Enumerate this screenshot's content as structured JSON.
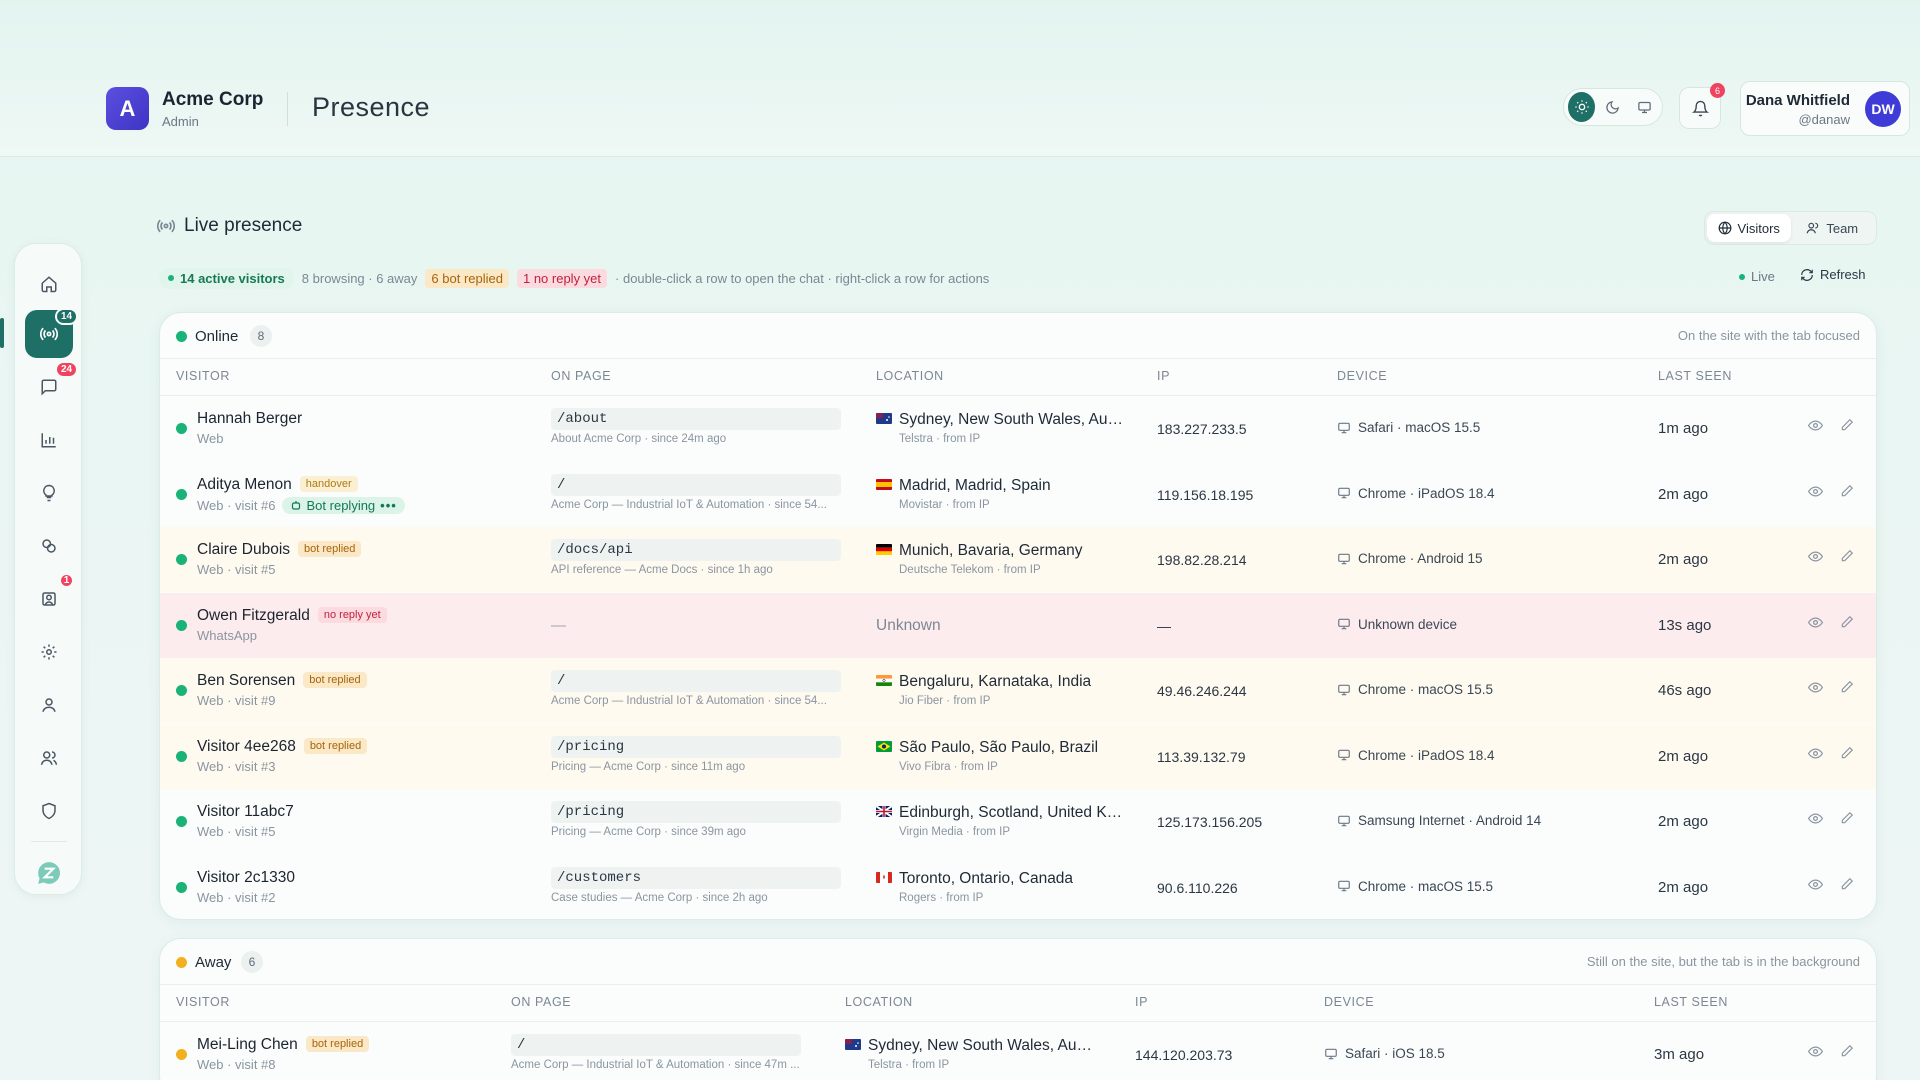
{
  "header": {
    "logo_letter": "A",
    "org_name": "Acme Corp",
    "org_role": "Admin",
    "page_title": "Presence",
    "notification_count": "6",
    "user_name": "Dana Whitfield",
    "user_handle": "@danaw",
    "user_initials": "DW"
  },
  "sidebar": {
    "items": [
      {
        "name": "home",
        "icon": "home-icon"
      },
      {
        "name": "presence",
        "icon": "broadcast-icon",
        "badge": "14",
        "active": true
      },
      {
        "name": "chats",
        "icon": "chat-icon",
        "badge": "24"
      },
      {
        "name": "analytics",
        "icon": "bar-chart-icon"
      },
      {
        "name": "ideas",
        "icon": "lightbulb-icon"
      },
      {
        "name": "integrations",
        "icon": "link-icon"
      },
      {
        "name": "tickets",
        "icon": "inbox-icon",
        "badge": "1"
      },
      {
        "name": "settings",
        "icon": "gear-icon"
      },
      {
        "name": "profile",
        "icon": "user-icon"
      },
      {
        "name": "team",
        "icon": "users-icon"
      },
      {
        "name": "security",
        "icon": "shield-icon"
      },
      {
        "name": "app",
        "icon": "app-logo-icon"
      }
    ]
  },
  "presence": {
    "title": "Live presence",
    "tabs": {
      "visitors": "Visitors",
      "team": "Team"
    },
    "stats": {
      "active": "14 active visitors",
      "browsing_away": "8 browsing · 6 away",
      "bot_replied": "6 bot replied",
      "no_reply": "1 no reply yet",
      "hint": "· double-click a row to open the chat · right-click a row for actions"
    },
    "live_label": "Live",
    "refresh_label": "Refresh"
  },
  "columns": {
    "visitor": "VISITOR",
    "on_page": "ON PAGE",
    "location": "LOCATION",
    "ip": "IP",
    "device": "DEVICE",
    "last_seen": "LAST SEEN"
  },
  "online": {
    "label": "Online",
    "count": "8",
    "note": "On the site with the tab focused",
    "rows": [
      {
        "name": "Hannah Berger",
        "sub": "Web",
        "tag": "",
        "bot": "",
        "page": "/about",
        "page_sub": "About Acme Corp · since 24m ago",
        "location": "Sydney, New South Wales, Aus...",
        "loc_sub": "Telstra · from IP",
        "flag": "au",
        "ip": "183.227.233.5",
        "device": "Safari · macOS 15.5",
        "seen": "1m ago",
        "tint": ""
      },
      {
        "name": "Aditya Menon",
        "sub": "Web · visit #6",
        "tag": "handover",
        "bot": "Bot replying",
        "page": "/",
        "page_sub": "Acme Corp — Industrial IoT & Automation · since 54...",
        "location": "Madrid, Madrid, Spain",
        "loc_sub": "Movistar · from IP",
        "flag": "es",
        "ip": "119.156.18.195",
        "device": "Chrome · iPadOS 18.4",
        "seen": "2m ago",
        "tint": ""
      },
      {
        "name": "Claire Dubois",
        "sub": "Web · visit #5",
        "tag": "bot replied",
        "bot": "",
        "page": "/docs/api",
        "page_sub": "API reference — Acme Docs · since 1h ago",
        "location": "Munich, Bavaria, Germany",
        "loc_sub": "Deutsche Telekom · from IP",
        "flag": "de",
        "ip": "198.82.28.214",
        "device": "Chrome · Android 15",
        "seen": "2m ago",
        "tint": "yellow"
      },
      {
        "name": "Owen Fitzgerald",
        "sub": "WhatsApp",
        "tag": "no reply yet",
        "bot": "",
        "page": "—",
        "page_sub": "",
        "location": "Unknown",
        "loc_sub": "",
        "flag": "",
        "ip": "—",
        "device": "Unknown device",
        "seen": "13s ago",
        "tint": "red"
      },
      {
        "name": "Ben Sorensen",
        "sub": "Web · visit #9",
        "tag": "bot replied",
        "bot": "",
        "page": "/",
        "page_sub": "Acme Corp — Industrial IoT & Automation · since 54...",
        "location": "Bengaluru, Karnataka, India",
        "loc_sub": "Jio Fiber · from IP",
        "flag": "in",
        "ip": "49.46.246.244",
        "device": "Chrome · macOS 15.5",
        "seen": "46s ago",
        "tint": "yellow"
      },
      {
        "name": "Visitor 4ee268",
        "sub": "Web · visit #3",
        "tag": "bot replied",
        "bot": "",
        "page": "/pricing",
        "page_sub": "Pricing — Acme Corp · since 11m ago",
        "location": "São Paulo, São Paulo, Brazil",
        "loc_sub": "Vivo Fibra · from IP",
        "flag": "br",
        "ip": "113.39.132.79",
        "device": "Chrome · iPadOS 18.4",
        "seen": "2m ago",
        "tint": "yellow"
      },
      {
        "name": "Visitor 11abc7",
        "sub": "Web · visit #5",
        "tag": "",
        "bot": "",
        "page": "/pricing",
        "page_sub": "Pricing — Acme Corp · since 39m ago",
        "location": "Edinburgh, Scotland, United Ki...",
        "loc_sub": "Virgin Media · from IP",
        "flag": "gb",
        "ip": "125.173.156.205",
        "device": "Samsung Internet · Android 14",
        "seen": "2m ago",
        "tint": ""
      },
      {
        "name": "Visitor 2c1330",
        "sub": "Web · visit #2",
        "tag": "",
        "bot": "",
        "page": "/customers",
        "page_sub": "Case studies — Acme Corp · since 2h ago",
        "location": "Toronto, Ontario, Canada",
        "loc_sub": "Rogers · from IP",
        "flag": "ca",
        "ip": "90.6.110.226",
        "device": "Chrome · macOS 15.5",
        "seen": "2m ago",
        "tint": ""
      }
    ]
  },
  "away": {
    "label": "Away",
    "count": "6",
    "note": "Still on the site, but the tab is in the background",
    "rows": [
      {
        "name": "Mei-Ling Chen",
        "sub": "Web · visit #8",
        "tag": "bot replied",
        "page": "/",
        "page_sub": "Acme Corp — Industrial IoT & Automation · since 47m ...",
        "location": "Sydney, New South Wales, Aust...",
        "loc_sub": "Telstra · from IP",
        "flag": "au",
        "ip": "144.120.203.73",
        "device": "Safari · iOS 18.5",
        "seen": "3m ago"
      }
    ]
  },
  "colors": {
    "accent": "#1e6f66",
    "online": "#19b378",
    "away": "#f2b01e",
    "badge": "#ef4460"
  }
}
